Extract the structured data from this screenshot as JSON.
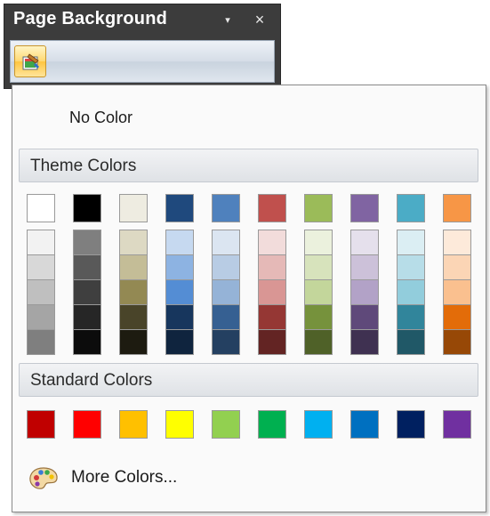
{
  "panel": {
    "title": "Page Background",
    "pin_glyph": "▾",
    "close_glyph": "×",
    "button_icon": "page-background-paint-icon"
  },
  "dropdown": {
    "no_color_label": "No Color",
    "theme_header": "Theme Colors",
    "standard_header": "Standard Colors",
    "more_colors_label": "More Colors...",
    "more_colors_icon": "palette-icon"
  },
  "theme_colors": [
    {
      "name": "white",
      "base": "#ffffff",
      "shades": [
        "#f2f2f2",
        "#d8d8d8",
        "#bfbfbf",
        "#a5a5a5",
        "#7f7f7f"
      ]
    },
    {
      "name": "black",
      "base": "#000000",
      "shades": [
        "#7f7f7f",
        "#595959",
        "#3f3f3f",
        "#262626",
        "#0c0c0c"
      ]
    },
    {
      "name": "tan",
      "base": "#eeece1",
      "shades": [
        "#ddd9c3",
        "#c4bd97",
        "#938953",
        "#494429",
        "#1d1b10"
      ]
    },
    {
      "name": "dark-blue",
      "base": "#1f497d",
      "shades": [
        "#c6d9f0",
        "#8db3e2",
        "#548dd4",
        "#17365d",
        "#0f243e"
      ]
    },
    {
      "name": "blue",
      "base": "#4f81bd",
      "shades": [
        "#dbe5f1",
        "#b8cce4",
        "#95b3d7",
        "#366092",
        "#244061"
      ]
    },
    {
      "name": "red",
      "base": "#c0504d",
      "shades": [
        "#f2dcdb",
        "#e5b9b7",
        "#d99694",
        "#953734",
        "#632423"
      ]
    },
    {
      "name": "olive-green",
      "base": "#9bbb59",
      "shades": [
        "#ebf1dd",
        "#d7e3bc",
        "#c3d69b",
        "#76923c",
        "#4f6128"
      ]
    },
    {
      "name": "purple",
      "base": "#8064a2",
      "shades": [
        "#e5e0ec",
        "#ccc1d9",
        "#b2a2c7",
        "#5f497a",
        "#3f3151"
      ]
    },
    {
      "name": "aqua",
      "base": "#4bacc6",
      "shades": [
        "#dbeef3",
        "#b7dde8",
        "#92cddc",
        "#31859b",
        "#205867"
      ]
    },
    {
      "name": "orange",
      "base": "#f79646",
      "shades": [
        "#fdeada",
        "#fbd5b5",
        "#fac08f",
        "#e36c09",
        "#974806"
      ]
    }
  ],
  "standard_colors": [
    {
      "name": "dark-red",
      "color": "#c00000"
    },
    {
      "name": "red",
      "color": "#ff0000"
    },
    {
      "name": "orange",
      "color": "#ffc000"
    },
    {
      "name": "yellow",
      "color": "#ffff00"
    },
    {
      "name": "light-green",
      "color": "#92d050"
    },
    {
      "name": "green",
      "color": "#00b050"
    },
    {
      "name": "light-blue",
      "color": "#00b0f0"
    },
    {
      "name": "blue",
      "color": "#0070c0"
    },
    {
      "name": "dark-blue",
      "color": "#002060"
    },
    {
      "name": "purple",
      "color": "#7030a0"
    }
  ]
}
